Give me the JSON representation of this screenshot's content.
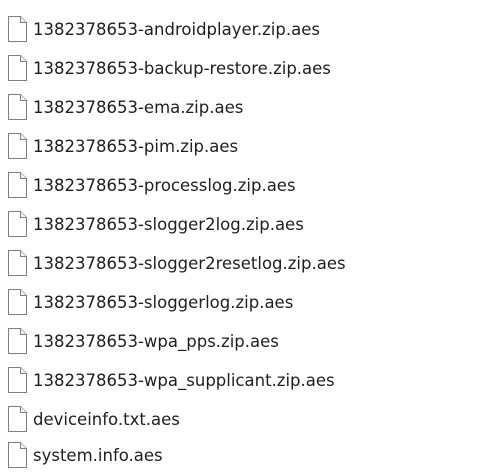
{
  "files": [
    {
      "name": "1382378653-androidplayer.zip.aes",
      "icon": "generic-file-icon"
    },
    {
      "name": "1382378653-backup-restore.zip.aes",
      "icon": "generic-file-icon"
    },
    {
      "name": "1382378653-ema.zip.aes",
      "icon": "generic-file-icon"
    },
    {
      "name": "1382378653-pim.zip.aes",
      "icon": "generic-file-icon"
    },
    {
      "name": "1382378653-processlog.zip.aes",
      "icon": "generic-file-icon"
    },
    {
      "name": "1382378653-slogger2log.zip.aes",
      "icon": "generic-file-icon"
    },
    {
      "name": "1382378653-slogger2resetlog.zip.aes",
      "icon": "generic-file-icon"
    },
    {
      "name": "1382378653-sloggerlog.zip.aes",
      "icon": "generic-file-icon"
    },
    {
      "name": "1382378653-wpa_pps.zip.aes",
      "icon": "generic-file-icon"
    },
    {
      "name": "1382378653-wpa_supplicant.zip.aes",
      "icon": "generic-file-icon"
    },
    {
      "name": "deviceinfo.txt.aes",
      "icon": "generic-file-icon"
    },
    {
      "name": "system.info.aes",
      "icon": "generic-file-icon"
    }
  ]
}
